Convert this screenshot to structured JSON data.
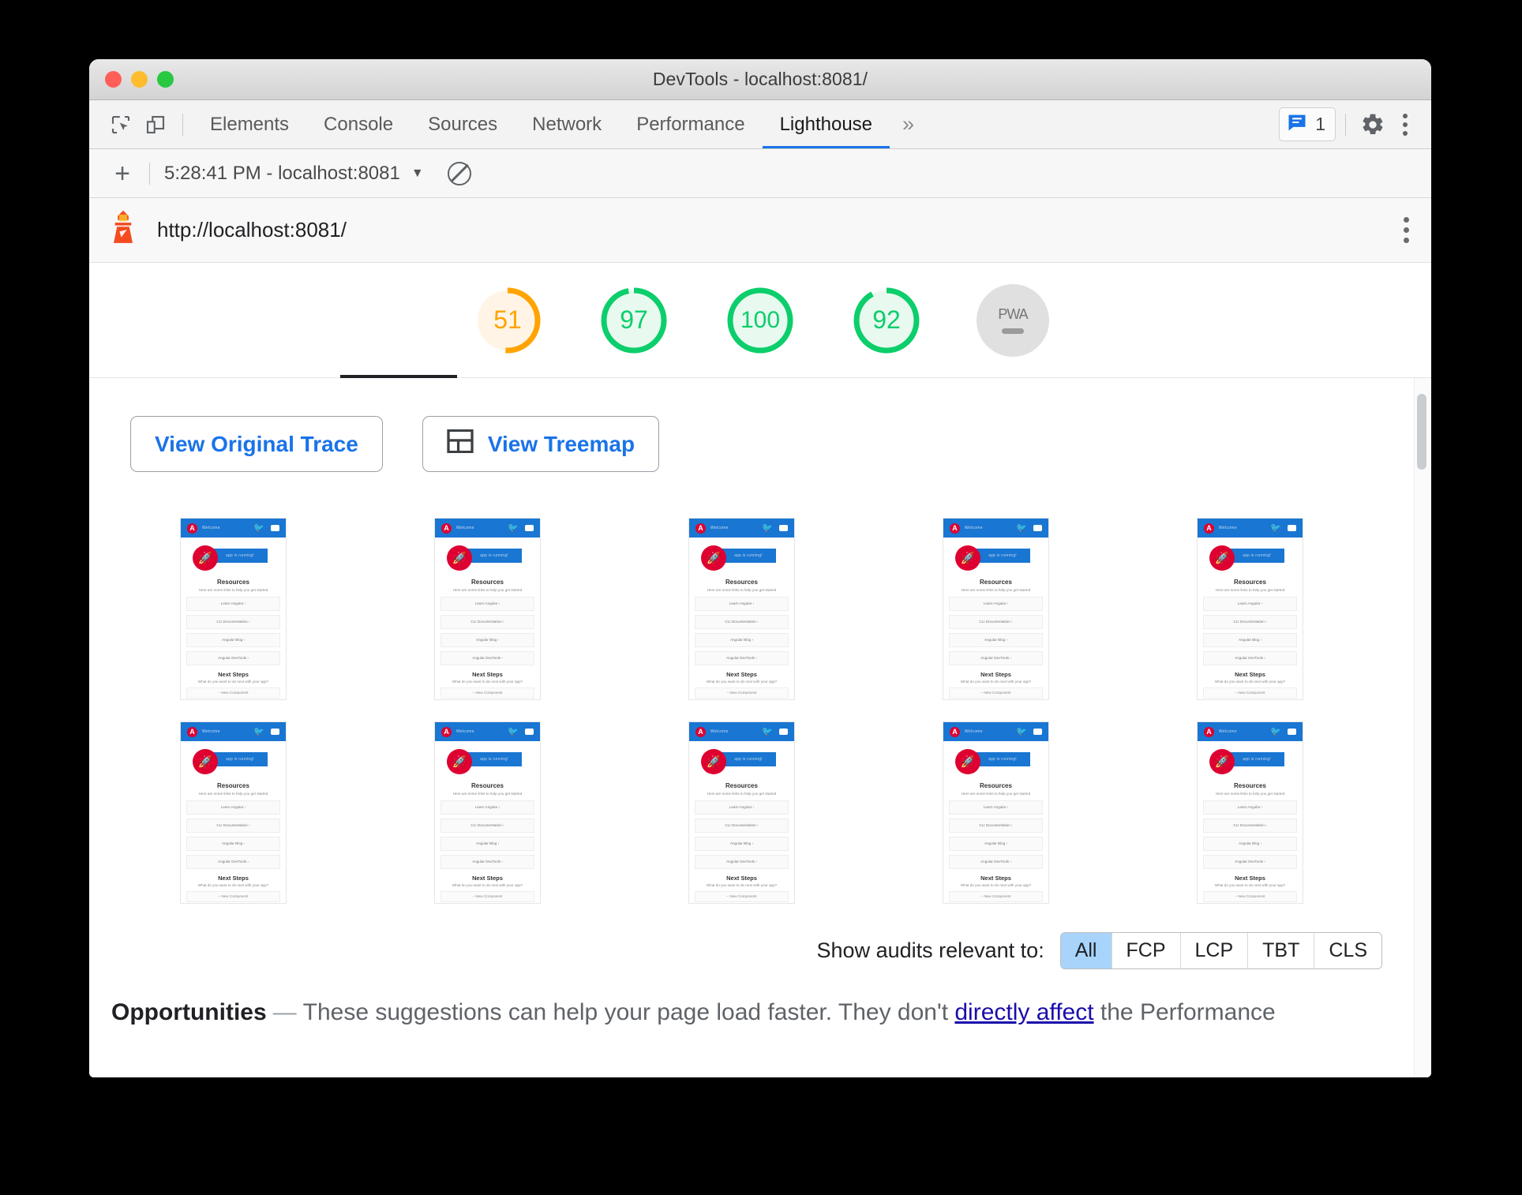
{
  "window": {
    "title": "DevTools - localhost:8081/",
    "traffic_lights": [
      "close",
      "minimize",
      "zoom"
    ]
  },
  "devtools_tabs": {
    "inspect_icon": "inspect-cursor-icon",
    "device_icon": "device-toolbar-icon",
    "items": [
      {
        "label": "Elements",
        "active": false
      },
      {
        "label": "Console",
        "active": false
      },
      {
        "label": "Sources",
        "active": false
      },
      {
        "label": "Network",
        "active": false
      },
      {
        "label": "Performance",
        "active": false
      },
      {
        "label": "Lighthouse",
        "active": true
      }
    ],
    "overflow_label": "»",
    "message_count": "1",
    "settings_icon": "gear-icon",
    "more_icon": "kebab-menu-icon"
  },
  "lighthouse_toolbar": {
    "add_label": "+",
    "report_select": "5:28:41 PM - localhost:8081",
    "caret": "▼",
    "clear_icon": "clear-all-icon"
  },
  "url_header": {
    "lighthouse_icon": "lighthouse-icon",
    "url": "http://localhost:8081/",
    "more_icon": "kebab-menu-icon"
  },
  "scores": [
    {
      "category": "performance",
      "value": "51",
      "color": "#ffa400",
      "track": "#fff4e5",
      "selected": true
    },
    {
      "category": "accessibility",
      "value": "97",
      "color": "#0cce6b",
      "track": "#e8f9f0",
      "selected": false
    },
    {
      "category": "best-practices",
      "value": "100",
      "color": "#0cce6b",
      "track": "#e8f9f0",
      "selected": false
    },
    {
      "category": "seo",
      "value": "92",
      "color": "#0cce6b",
      "track": "#e8f9f0",
      "selected": false
    },
    {
      "category": "pwa",
      "value": "—",
      "label": "PWA",
      "color": "#9a9a9a",
      "track": "#e0e0e0",
      "selected": false
    }
  ],
  "actions": {
    "view_original_trace": "View Original Trace",
    "view_treemap": "View Treemap",
    "treemap_icon": "treemap-icon"
  },
  "filmstrip": {
    "count": 10,
    "frame": {
      "brand": "Welcome",
      "logo_letter": "A",
      "twitter_icon": "twitter-icon",
      "youtube_icon": "youtube-icon",
      "rocket_icon": "rocket-icon",
      "banner_text": "app is running!",
      "heading": "Resources",
      "subheading": "Here are some links to help you get started",
      "cards": [
        "Learn Angular",
        "CLI Documentation",
        "Angular Blog",
        "Angular DevTools"
      ],
      "next_heading": "Next Steps",
      "next_sub": "What do you want to do next with your app?",
      "next_card": "New Component"
    }
  },
  "audit_filters": {
    "label": "Show audits relevant to:",
    "options": [
      {
        "label": "All",
        "selected": true
      },
      {
        "label": "FCP",
        "selected": false
      },
      {
        "label": "LCP",
        "selected": false
      },
      {
        "label": "TBT",
        "selected": false
      },
      {
        "label": "CLS",
        "selected": false
      }
    ]
  },
  "opportunities": {
    "title": "Opportunities",
    "dash": "—",
    "text_before": "These suggestions can help your page load faster. They don't ",
    "link": "directly affect",
    "text_after": " the Performance"
  },
  "colors": {
    "accent_blue": "#1a73e8",
    "score_orange": "#ffa400",
    "score_green": "#0cce6b",
    "link_blue": "#1a0dab",
    "segment_selected": "#a8d4fb"
  }
}
